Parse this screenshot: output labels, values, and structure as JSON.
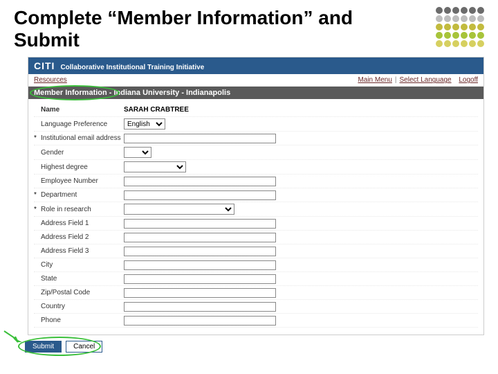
{
  "slide": {
    "title": "Complete “Member Information” and Submit"
  },
  "header": {
    "logo": "CITI",
    "subtitle": "Collaborative Institutional Training Initiative"
  },
  "nav": {
    "resources": "Resources",
    "main_menu": "Main Menu",
    "select_language": "Select Language",
    "logoff": "Logoff"
  },
  "section": {
    "title": "Member Information - Indiana University - Indianapolis"
  },
  "form": {
    "name_label": "Name",
    "name_value": "SARAH CRABTREE",
    "language_label": "Language Preference",
    "language_value": "English",
    "email_label": "Institutional email address",
    "gender_label": "Gender",
    "degree_label": "Highest degree",
    "empno_label": "Employee Number",
    "dept_label": "Department",
    "role_label": "Role in research",
    "addr1_label": "Address Field 1",
    "addr2_label": "Address Field 2",
    "addr3_label": "Address Field 3",
    "city_label": "City",
    "state_label": "State",
    "zip_label": "Zip/Postal Code",
    "country_label": "Country",
    "phone_label": "Phone"
  },
  "buttons": {
    "submit": "Submit",
    "cancel": "Cancel"
  },
  "deco": {
    "colors": [
      "#6b6b6b",
      "#6b6b6b",
      "#6b6b6b",
      "#6b6b6b",
      "#6b6b6b",
      "#6b6b6b",
      "#bdbdbd",
      "#bdbdbd",
      "#bdbdbd",
      "#bdbdbd",
      "#bdbdbd",
      "#bdbdbd",
      "#c2bb3e",
      "#c2bb3e",
      "#c2bb3e",
      "#c2bb3e",
      "#c2bb3e",
      "#c2bb3e",
      "#a7c43a",
      "#a7c43a",
      "#a7c43a",
      "#a7c43a",
      "#a7c43a",
      "#a7c43a",
      "#d6d060",
      "#d6d060",
      "#d6d060",
      "#d6d060",
      "#d6d060",
      "#d6d060"
    ]
  }
}
